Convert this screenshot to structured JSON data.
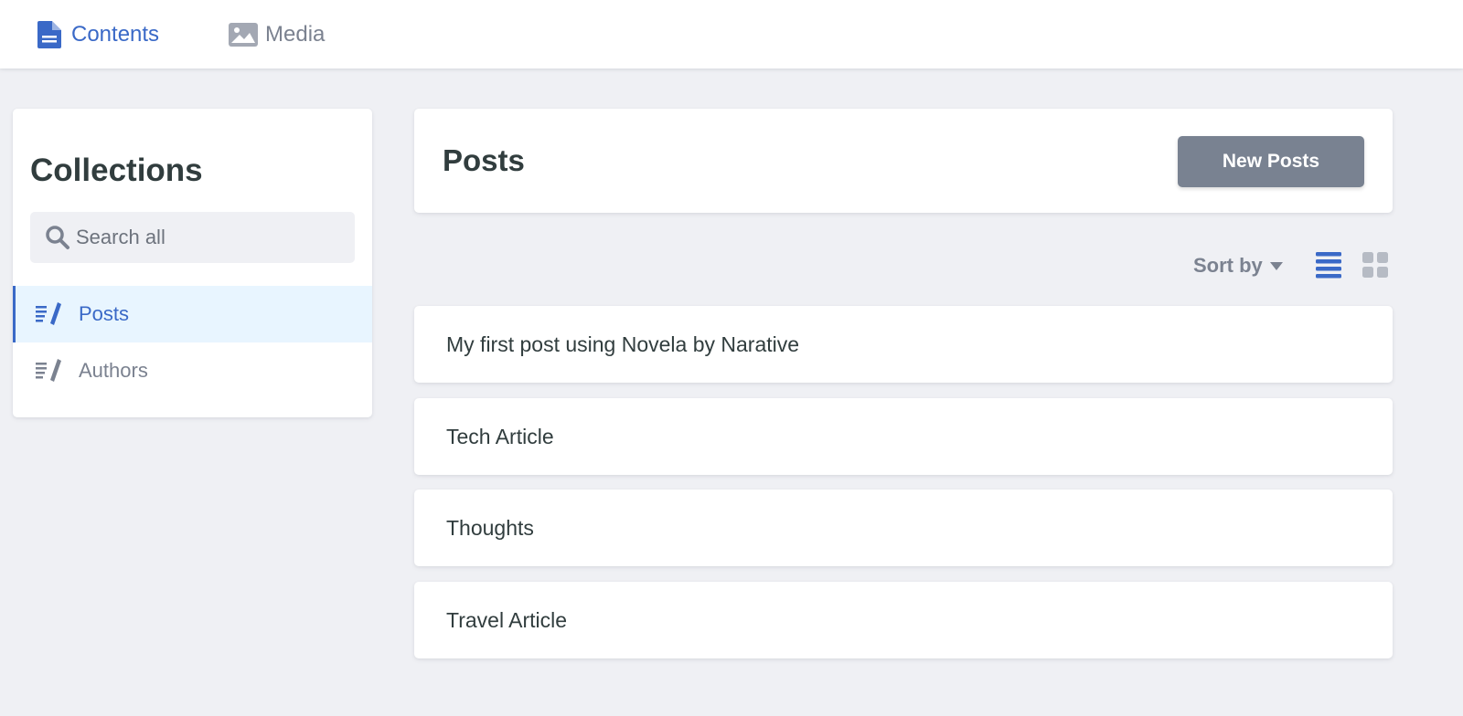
{
  "nav": {
    "tabs": [
      {
        "label": "Contents",
        "icon": "document-icon",
        "active": true
      },
      {
        "label": "Media",
        "icon": "image-icon",
        "active": false
      }
    ]
  },
  "sidebar": {
    "title": "Collections",
    "search_placeholder": "Search all",
    "items": [
      {
        "label": "Posts",
        "icon": "edit-list-icon",
        "active": true
      },
      {
        "label": "Authors",
        "icon": "edit-list-icon",
        "active": false
      }
    ]
  },
  "main": {
    "title": "Posts",
    "new_button_label": "New Posts",
    "sort_label": "Sort by",
    "view_mode": "list",
    "entries": [
      "My first post using Novela by Narative",
      "Tech Article",
      "Thoughts",
      "Travel Article"
    ]
  },
  "colors": {
    "accent": "#3a69c7",
    "muted": "#7b8290",
    "background": "#eff0f4",
    "button": "#798291",
    "active_bg": "#e8f5ff"
  }
}
